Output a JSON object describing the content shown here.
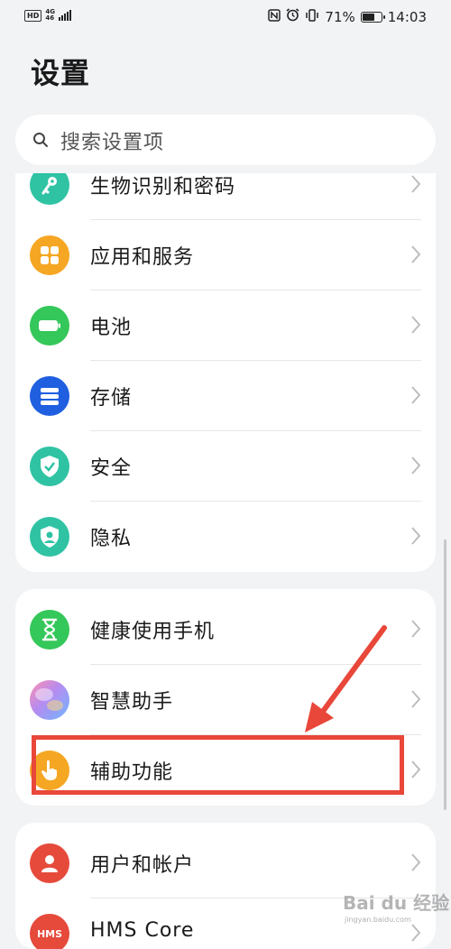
{
  "status_bar": {
    "hd": "HD",
    "net_top": "4G",
    "net_bottom": "46",
    "battery_percent": "71%",
    "battery_level": 0.71,
    "time": "14:03",
    "icons": [
      "nfc-icon",
      "alarm-icon",
      "vibrate-icon",
      "battery-icon",
      "signal-icon"
    ]
  },
  "page": {
    "title": "设置"
  },
  "search": {
    "placeholder": "搜索设置项"
  },
  "groups": [
    {
      "items": [
        {
          "label": "生物识别和密码",
          "icon": "key-icon",
          "color": "#2fc3a4"
        },
        {
          "label": "应用和服务",
          "icon": "apps-grid-icon",
          "color": "#f5a623"
        },
        {
          "label": "电池",
          "icon": "battery-icon",
          "color": "#34c759"
        },
        {
          "label": "存储",
          "icon": "storage-icon",
          "color": "#1f5fe0"
        },
        {
          "label": "安全",
          "icon": "shield-check-icon",
          "color": "#2fc3a4"
        },
        {
          "label": "隐私",
          "icon": "privacy-shield-icon",
          "color": "#2fc3a4"
        }
      ]
    },
    {
      "items": [
        {
          "label": "健康使用手机",
          "icon": "hourglass-icon",
          "color": "#34c759"
        },
        {
          "label": "智慧助手",
          "icon": "assistant-orb-icon",
          "color": "#b58cf0"
        },
        {
          "label": "辅助功能",
          "icon": "hand-pointer-icon",
          "color": "#f5a623"
        }
      ]
    },
    {
      "items": [
        {
          "label": "用户和帐户",
          "icon": "user-icon",
          "color": "#e64a3b"
        },
        {
          "label": "HMS Core",
          "icon": "hms-icon",
          "color": "#e64a3b",
          "badge": "HMS"
        }
      ]
    }
  ],
  "annotation": {
    "color": "#e8473a",
    "highlighted_item": "辅助功能"
  },
  "watermark": {
    "text": "Bai du 经验",
    "sub": "jingyan.baidu.com"
  }
}
